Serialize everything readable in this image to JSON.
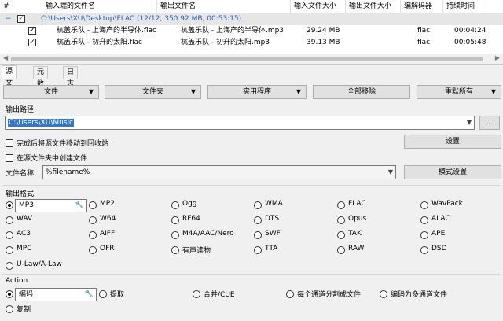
{
  "list": {
    "headers": [
      "#",
      "输入端的文件名",
      "输出文件名",
      "输入文件大小",
      "输出文件大小",
      "编解码器",
      "持续时间"
    ],
    "group": {
      "path": "C:\\Users\\XU\\Desktop\\FLAC (12/12, 350.92 MB, 00:53:15)"
    },
    "rows": [
      {
        "input": "杭盖乐队 - 上海产的半导体.flac",
        "output": "杭盖乐队 - 上海产的半导体.mp3",
        "size": "29.24 MB",
        "out_size": "",
        "codec": "flac",
        "duration": "00:04:24"
      },
      {
        "input": "杭盖乐队 - 初升的太阳.flac",
        "output": "杭盖乐队 - 初升的太阳.mp3",
        "size": "39.13 MB",
        "out_size": "",
        "codec": "flac",
        "duration": "00:05:48"
      }
    ],
    "check_mark": "✓"
  },
  "tabs": [
    "源文件",
    "元数据",
    "日志"
  ],
  "toolbar": {
    "file": "文件",
    "folder": "文件夹",
    "utilities": "实用程序",
    "remove_all": "全部移除",
    "reset_all": "重默所有"
  },
  "output_path": {
    "label": "输出路径",
    "value": "C:\\Users\\XU\\Music",
    "browse": "...",
    "recycle": "完成后将源文件移动到回收站",
    "settings": "设置",
    "in_source": "在源文件夹中创建文件",
    "name_label": "文件名称:",
    "pattern": "%filename%",
    "pattern_settings": "模式设置"
  },
  "output_format": {
    "label": "输出格式",
    "selected": "MP3",
    "options": [
      [
        "MP3",
        "MP2",
        "Ogg",
        "WMA",
        "FLAC",
        "WavPack"
      ],
      [
        "WAV",
        "W64",
        "RF64",
        "DTS",
        "Opus",
        "ALAC"
      ],
      [
        "AC3",
        "AIFF",
        "M4A/AAC/Nero",
        "SWF",
        "TAK",
        "APE"
      ],
      [
        "MPC",
        "OFR",
        "有声读物",
        "TTA",
        "RAW",
        "DSD"
      ],
      [
        "U-Law/A-Law"
      ]
    ]
  },
  "action": {
    "label": "Action",
    "selected": "编码",
    "options": [
      "编码",
      "提取",
      "合并/CUE",
      "每个通道分割成文件",
      "编码为多通道文件",
      "复制"
    ]
  },
  "icons": {
    "wrench": "🔧",
    "dropdown": "▼",
    "minus": "−"
  }
}
